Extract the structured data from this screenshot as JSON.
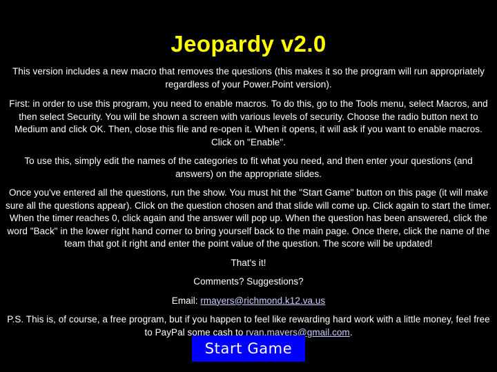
{
  "slide": {
    "title": "Jeopardy v2.0",
    "background_color": "#000000",
    "title_color": "#ffff00",
    "text_color": "#ffffff",
    "link_color": "#ccccff",
    "button_color": "#0000ff"
  },
  "paragraphs": {
    "intro": "This version includes a new macro that removes the questions (this makes it so the program will run appropriately regardless of your Power.Point version).",
    "macros": "First: in order to use this program, you need to enable macros.  To do this, go to the Tools menu, select Macros, and then select Security.  You will be shown a screen with various levels of security.  Choose the radio button next to Medium and click OK.  Then, close this file and re-open it.  When it opens, it will ask if you want to enable macros.  Click on \"Enable\".",
    "usage": "To use this, simply edit the names of the categories to fit what you need, and then enter your questions (and answers) on the appropriate slides.",
    "gameplay": "Once you've entered all the questions, run the show.  You must hit the \"Start Game\" button on this page (it will make sure all the questions appear).  Click on the question chosen and that slide will come up.  Click again to start the timer.  When the timer reaches 0, click again and the answer will pop up.  When the question has been answered, click the word \"Back\" in the lower right hand corner to bring yourself back to the main page.  Once there, click the name of the team that got it right and enter the point value of the question.  The score will be updated!",
    "thats_it": "That's it!",
    "comments": "Comments?  Suggestions?",
    "email_label": "Email: ",
    "email_address": "rmayers@richmond.k12.va.us",
    "ps_before_link": "P.S. This is, of course, a free program, but if you happen to feel like rewarding hard work with a little money, feel free to PayPal some cash to ",
    "paypal_address": "ryan.mayers@gmail.com",
    "ps_after_link": "."
  },
  "button": {
    "start_label": "Start Game"
  }
}
